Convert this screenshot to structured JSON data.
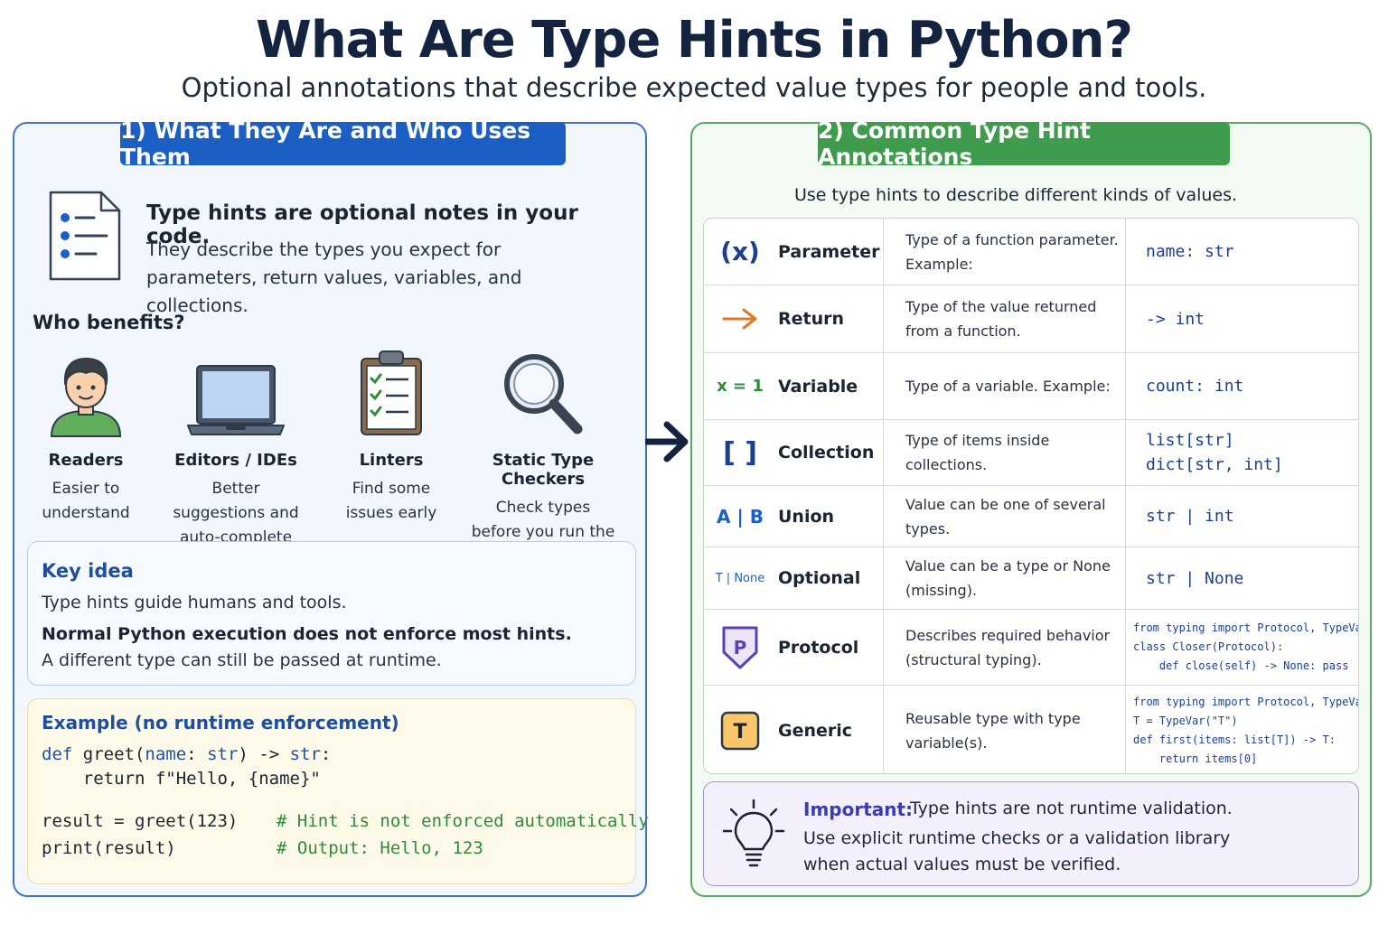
{
  "header": {
    "title": "What Are Type Hints in Python?",
    "subtitle": "Optional annotations that describe expected value types for people and tools."
  },
  "left_panel": {
    "heading": "1) What They Are and Who Uses Them",
    "intro_title": "Type hints are optional notes in your code.",
    "intro_body": "They describe the types you expect for parameters, return values, variables, and collections.",
    "benefits_title": "Who benefits?",
    "benefits": [
      {
        "name": "Readers",
        "desc": "Easier to understand",
        "icon": "person-icon"
      },
      {
        "name": "Editors / IDEs",
        "desc": "Better suggestions and auto-complete",
        "icon": "laptop-icon"
      },
      {
        "name": "Linters",
        "desc": "Find some issues early",
        "icon": "clipboard-checklist-icon"
      },
      {
        "name": "Static Type Checkers",
        "desc": "Check types before you run the code",
        "icon": "magnifier-icon"
      }
    ],
    "key_idea": {
      "title": "Key idea",
      "line1": "Type hints guide humans and tools.",
      "line2": "Normal Python execution does not enforce most hints.",
      "line3": "A different type can still be passed at runtime."
    },
    "example": {
      "title": "Example (no runtime enforcement)",
      "code_line1_kw": "def",
      "code_line1_rest": " greet(",
      "code_line1_param": "name",
      "code_line1_colon": ": ",
      "code_line1_type": "str",
      "code_line1_arrow": ") -> ",
      "code_line1_ret": "str",
      "code_line1_end": ":",
      "code_line2": "    return f\"Hello, {name}\"",
      "code_line3": "result = greet(123)",
      "code_line3_comment": "# Hint is not enforced automatically",
      "code_line4": "print(result)",
      "code_line4_comment": "# Output: Hello, 123"
    }
  },
  "right_panel": {
    "heading": "2) Common Type Hint Annotations",
    "intro": "Use type hints to describe different kinds of values.",
    "rows": [
      {
        "symbol": "(x)",
        "name": "Parameter",
        "desc": "Type of a function parameter. Example:",
        "code": [
          "name: str"
        ]
      },
      {
        "symbol": "→",
        "name": "Return",
        "desc": "Type of the value returned from a function.",
        "code": [
          "-> int"
        ]
      },
      {
        "symbol": "x = 1",
        "name": "Variable",
        "desc": "Type of a variable. Example:",
        "code": [
          "count: int"
        ]
      },
      {
        "symbol": "[ ]",
        "name": "Collection",
        "desc": "Type of items inside collections.",
        "code": [
          "list[str]",
          "dict[str, int]"
        ]
      },
      {
        "symbol": "A | B",
        "name": "Union",
        "desc": "Value can be one of several types.",
        "code": [
          "str | int"
        ]
      },
      {
        "symbol": "T | None",
        "name": "Optional",
        "desc": "Value can be a type or None (missing).",
        "code": [
          "str | None"
        ]
      },
      {
        "symbol": "P",
        "name": "Protocol",
        "desc": "Describes required behavior (structural typing).",
        "code": [
          "from typing import Protocol, TypeVar",
          "class Closer(Protocol):",
          "    def close(self) -> None: pass"
        ]
      },
      {
        "symbol": "T",
        "name": "Generic",
        "desc": "Reusable type with type variable(s).",
        "code": [
          "from typing import Protocol, TypeVar",
          "T = TypeVar(\"T\")",
          "def first(items: list[T]) -> T:",
          "    return items[0]"
        ]
      }
    ],
    "important": {
      "label": "Important:",
      "line1": "Type hints are not runtime validation.",
      "line2": "Use explicit runtime checks or a validation library",
      "line3": "when actual values must be verified."
    }
  },
  "colors": {
    "left_accent": "#1b5fc4",
    "right_accent": "#3f9c4d",
    "code_blue": "#1d3f8f",
    "comment_green": "#2f8a3a",
    "important_purple": "#3c3cae"
  }
}
